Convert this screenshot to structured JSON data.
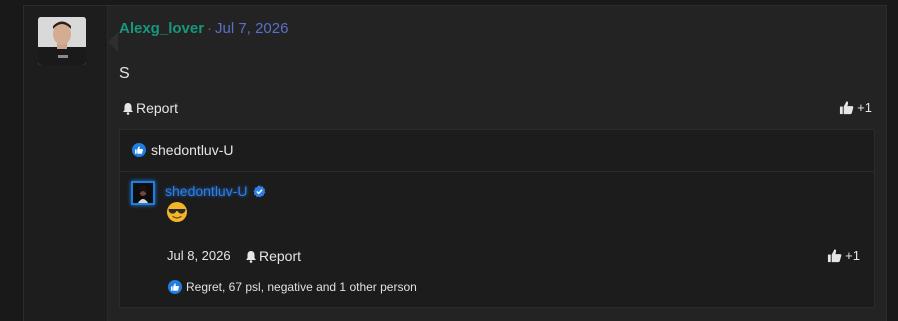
{
  "post": {
    "username": "Alexg_lover",
    "separator": "·",
    "date": "Jul 7, 2026",
    "body": "S",
    "report_label": "Report",
    "like_count": "+1"
  },
  "reply_section": {
    "header_user": "shedontluv-U",
    "reply": {
      "username": "shedontluv-U",
      "emoji": "sunglasses-face-emoji",
      "date": "Jul 8, 2026",
      "report_label": "Report",
      "like_count": "+1",
      "reactions_text": "Regret, 67 psl, negative and 1 other person"
    }
  },
  "colors": {
    "username": "#17977b",
    "date": "#5c6fc8",
    "reply_username": "#2f7fe6",
    "like_badge": "#1e7fe0"
  }
}
